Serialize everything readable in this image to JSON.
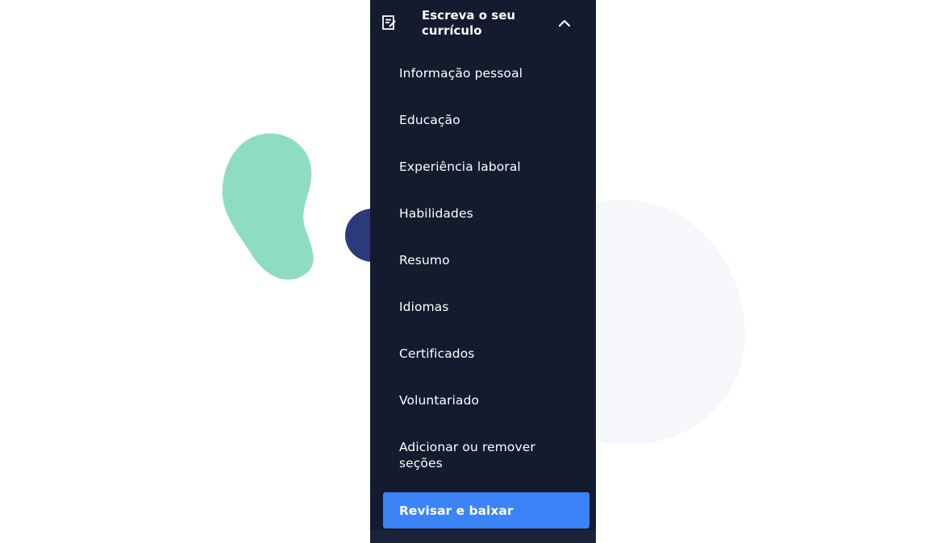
{
  "colors": {
    "sidebar_bg": "#141b2e",
    "accent": "#3b83f6",
    "decor_teal": "#8edcc4",
    "decor_navy": "#2b3a7a",
    "decor_gray": "#f5f7fa"
  },
  "sidebar": {
    "header": {
      "icon": "edit-document-icon",
      "title": "Escreva o seu currículo",
      "collapse_icon": "chevron-up-icon"
    },
    "items": [
      {
        "label": "Informação pessoal"
      },
      {
        "label": "Educação"
      },
      {
        "label": "Experiência laboral"
      },
      {
        "label": "Habilidades"
      },
      {
        "label": "Resumo"
      },
      {
        "label": "Idiomas"
      },
      {
        "label": "Certificados"
      },
      {
        "label": "Voluntariado"
      },
      {
        "label": "Adicionar ou remover seções"
      }
    ],
    "cta_label": "Revisar e baixar"
  }
}
